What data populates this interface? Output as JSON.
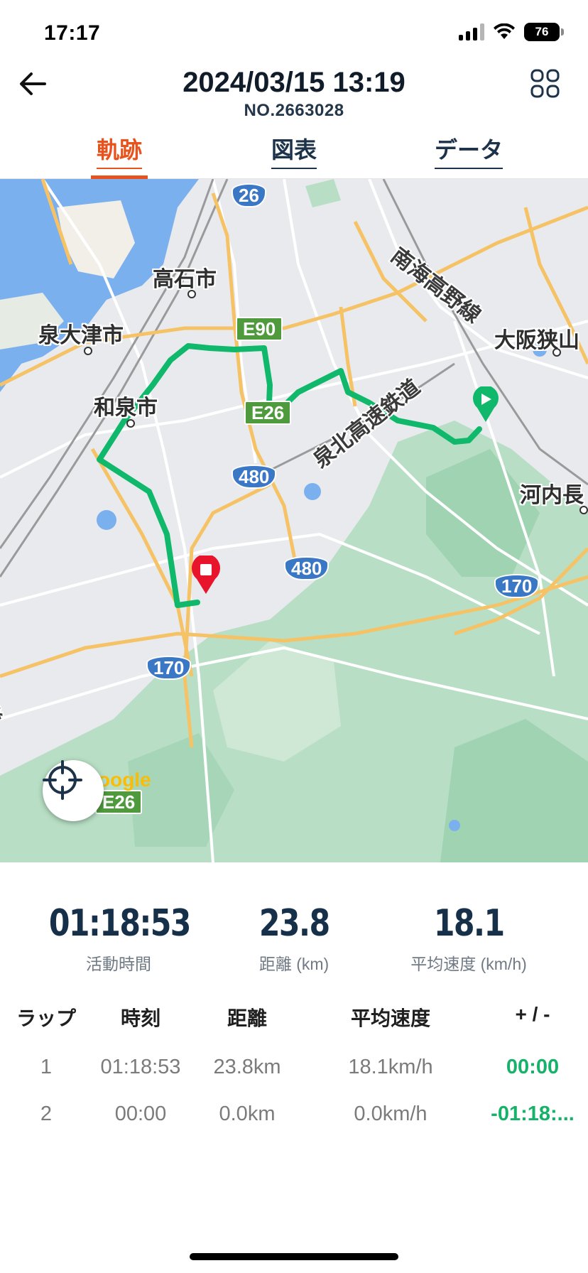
{
  "status_bar": {
    "time": "17:17",
    "battery": "76",
    "icons": [
      "cellular-signal-icon",
      "wifi-icon",
      "battery-icon"
    ]
  },
  "header": {
    "back_icon": "arrow-left-icon",
    "title": "2024/03/15 13:19",
    "subtitle": "NO.2663028",
    "grid_icon": "grid-menu-icon"
  },
  "tabs": [
    {
      "label": "軌跡",
      "active": true
    },
    {
      "label": "図表",
      "active": false
    },
    {
      "label": "データ",
      "active": false
    }
  ],
  "map": {
    "place_labels": [
      "高石市",
      "泉大津市",
      "和泉市",
      "大阪狭山",
      "河内長"
    ],
    "rail_labels": [
      "南海高野線",
      "泉北高速鉄道",
      "鉄道"
    ],
    "road_shields": {
      "blue": [
        "26",
        "480",
        "480",
        "170",
        "170"
      ],
      "green": [
        "E90",
        "E26",
        "E26"
      ]
    },
    "google_logo": "oogle",
    "route_color": "#0fb86a",
    "start_marker": "play-marker-icon",
    "end_marker": "stop-marker-icon",
    "locate_icon": "crosshair-icon"
  },
  "stats": [
    {
      "value": "01:18:53",
      "label": "活動時間"
    },
    {
      "value": "23.8",
      "label": "距離 (km)"
    },
    {
      "value": "18.1",
      "label": "平均速度 (km/h)"
    }
  ],
  "laps": {
    "headers": [
      "ラップ",
      "時刻",
      "距離",
      "平均速度",
      "+ / -"
    ],
    "rows": [
      [
        "1",
        "01:18:53",
        "23.8km",
        "18.1km/h",
        "00:00"
      ],
      [
        "2",
        "00:00",
        "0.0km",
        "0.0km/h",
        "-01:18:..."
      ]
    ]
  },
  "colors": {
    "accent": "#e8521c",
    "positive": "#17b26a",
    "text_dark": "#16304a"
  }
}
